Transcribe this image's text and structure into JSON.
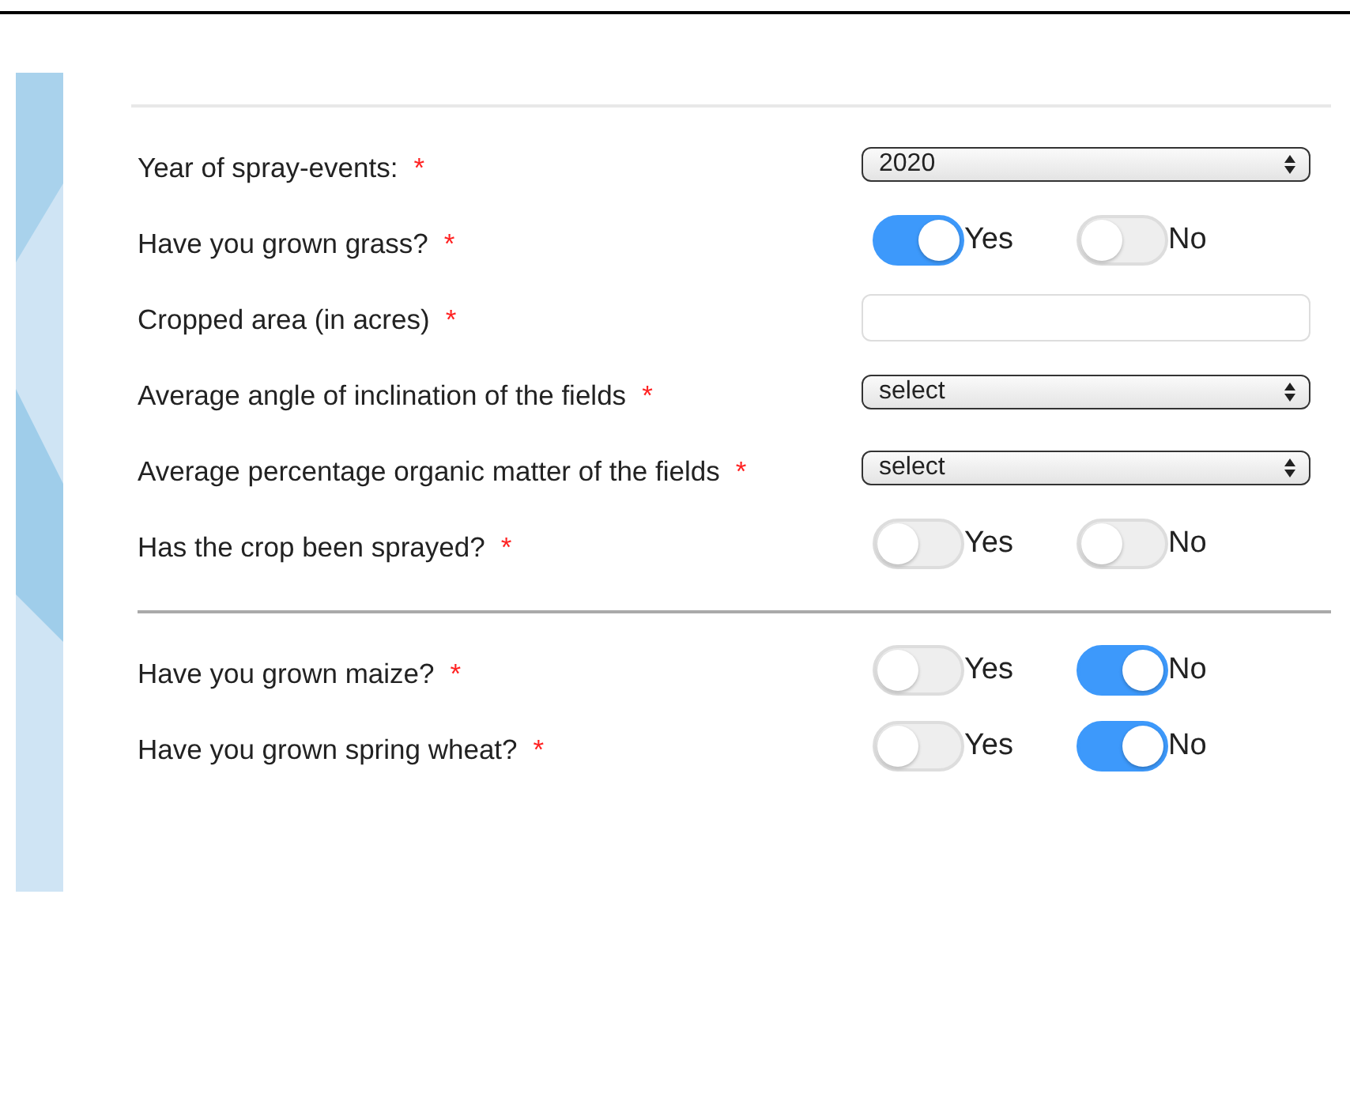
{
  "sections": [
    {
      "questions": [
        {
          "kind": "select",
          "label": "Year of spray-events:",
          "required": "*",
          "value": "2020"
        },
        {
          "kind": "toggle",
          "label": "Have you grown grass?",
          "required": "*",
          "options": [
            {
              "label": "Yes",
              "selected": true
            },
            {
              "label": "No",
              "selected": false
            }
          ]
        },
        {
          "kind": "text",
          "label": "Cropped area (in acres)",
          "required": "*"
        },
        {
          "kind": "select",
          "label": "Average angle of inclination of the fields",
          "required": "*",
          "value": "select"
        },
        {
          "kind": "select",
          "label": "Average percentage organic matter of the fields",
          "required": "*",
          "value": "select"
        },
        {
          "kind": "toggle",
          "label": "Has the crop been sprayed?",
          "required": "*",
          "options": [
            {
              "label": "Yes",
              "selected": false
            },
            {
              "label": "No",
              "selected": false
            }
          ]
        }
      ]
    },
    {
      "questions": [
        {
          "kind": "toggle",
          "label": "Have you grown maize?",
          "required": "*",
          "options": [
            {
              "label": "Yes",
              "selected": false
            },
            {
              "label": "No",
              "selected": true
            }
          ]
        },
        {
          "kind": "toggle",
          "label": "Have you grown spring wheat?",
          "required": "*",
          "options": [
            {
              "label": "Yes",
              "selected": false
            },
            {
              "label": "No",
              "selected": true
            }
          ]
        }
      ]
    }
  ]
}
